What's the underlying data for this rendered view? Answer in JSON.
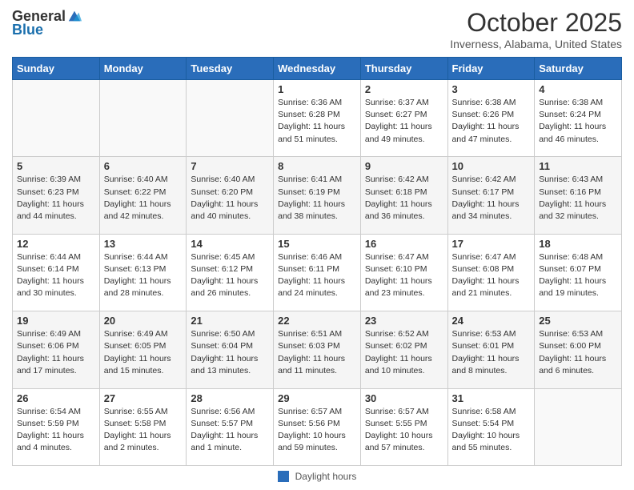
{
  "header": {
    "logo_general": "General",
    "logo_blue": "Blue",
    "title": "October 2025",
    "location": "Inverness, Alabama, United States"
  },
  "days_of_week": [
    "Sunday",
    "Monday",
    "Tuesday",
    "Wednesday",
    "Thursday",
    "Friday",
    "Saturday"
  ],
  "weeks": [
    [
      {
        "day": "",
        "info": ""
      },
      {
        "day": "",
        "info": ""
      },
      {
        "day": "",
        "info": ""
      },
      {
        "day": "1",
        "info": "Sunrise: 6:36 AM\nSunset: 6:28 PM\nDaylight: 11 hours\nand 51 minutes."
      },
      {
        "day": "2",
        "info": "Sunrise: 6:37 AM\nSunset: 6:27 PM\nDaylight: 11 hours\nand 49 minutes."
      },
      {
        "day": "3",
        "info": "Sunrise: 6:38 AM\nSunset: 6:26 PM\nDaylight: 11 hours\nand 47 minutes."
      },
      {
        "day": "4",
        "info": "Sunrise: 6:38 AM\nSunset: 6:24 PM\nDaylight: 11 hours\nand 46 minutes."
      }
    ],
    [
      {
        "day": "5",
        "info": "Sunrise: 6:39 AM\nSunset: 6:23 PM\nDaylight: 11 hours\nand 44 minutes."
      },
      {
        "day": "6",
        "info": "Sunrise: 6:40 AM\nSunset: 6:22 PM\nDaylight: 11 hours\nand 42 minutes."
      },
      {
        "day": "7",
        "info": "Sunrise: 6:40 AM\nSunset: 6:20 PM\nDaylight: 11 hours\nand 40 minutes."
      },
      {
        "day": "8",
        "info": "Sunrise: 6:41 AM\nSunset: 6:19 PM\nDaylight: 11 hours\nand 38 minutes."
      },
      {
        "day": "9",
        "info": "Sunrise: 6:42 AM\nSunset: 6:18 PM\nDaylight: 11 hours\nand 36 minutes."
      },
      {
        "day": "10",
        "info": "Sunrise: 6:42 AM\nSunset: 6:17 PM\nDaylight: 11 hours\nand 34 minutes."
      },
      {
        "day": "11",
        "info": "Sunrise: 6:43 AM\nSunset: 6:16 PM\nDaylight: 11 hours\nand 32 minutes."
      }
    ],
    [
      {
        "day": "12",
        "info": "Sunrise: 6:44 AM\nSunset: 6:14 PM\nDaylight: 11 hours\nand 30 minutes."
      },
      {
        "day": "13",
        "info": "Sunrise: 6:44 AM\nSunset: 6:13 PM\nDaylight: 11 hours\nand 28 minutes."
      },
      {
        "day": "14",
        "info": "Sunrise: 6:45 AM\nSunset: 6:12 PM\nDaylight: 11 hours\nand 26 minutes."
      },
      {
        "day": "15",
        "info": "Sunrise: 6:46 AM\nSunset: 6:11 PM\nDaylight: 11 hours\nand 24 minutes."
      },
      {
        "day": "16",
        "info": "Sunrise: 6:47 AM\nSunset: 6:10 PM\nDaylight: 11 hours\nand 23 minutes."
      },
      {
        "day": "17",
        "info": "Sunrise: 6:47 AM\nSunset: 6:08 PM\nDaylight: 11 hours\nand 21 minutes."
      },
      {
        "day": "18",
        "info": "Sunrise: 6:48 AM\nSunset: 6:07 PM\nDaylight: 11 hours\nand 19 minutes."
      }
    ],
    [
      {
        "day": "19",
        "info": "Sunrise: 6:49 AM\nSunset: 6:06 PM\nDaylight: 11 hours\nand 17 minutes."
      },
      {
        "day": "20",
        "info": "Sunrise: 6:49 AM\nSunset: 6:05 PM\nDaylight: 11 hours\nand 15 minutes."
      },
      {
        "day": "21",
        "info": "Sunrise: 6:50 AM\nSunset: 6:04 PM\nDaylight: 11 hours\nand 13 minutes."
      },
      {
        "day": "22",
        "info": "Sunrise: 6:51 AM\nSunset: 6:03 PM\nDaylight: 11 hours\nand 11 minutes."
      },
      {
        "day": "23",
        "info": "Sunrise: 6:52 AM\nSunset: 6:02 PM\nDaylight: 11 hours\nand 10 minutes."
      },
      {
        "day": "24",
        "info": "Sunrise: 6:53 AM\nSunset: 6:01 PM\nDaylight: 11 hours\nand 8 minutes."
      },
      {
        "day": "25",
        "info": "Sunrise: 6:53 AM\nSunset: 6:00 PM\nDaylight: 11 hours\nand 6 minutes."
      }
    ],
    [
      {
        "day": "26",
        "info": "Sunrise: 6:54 AM\nSunset: 5:59 PM\nDaylight: 11 hours\nand 4 minutes."
      },
      {
        "day": "27",
        "info": "Sunrise: 6:55 AM\nSunset: 5:58 PM\nDaylight: 11 hours\nand 2 minutes."
      },
      {
        "day": "28",
        "info": "Sunrise: 6:56 AM\nSunset: 5:57 PM\nDaylight: 11 hours\nand 1 minute."
      },
      {
        "day": "29",
        "info": "Sunrise: 6:57 AM\nSunset: 5:56 PM\nDaylight: 10 hours\nand 59 minutes."
      },
      {
        "day": "30",
        "info": "Sunrise: 6:57 AM\nSunset: 5:55 PM\nDaylight: 10 hours\nand 57 minutes."
      },
      {
        "day": "31",
        "info": "Sunrise: 6:58 AM\nSunset: 5:54 PM\nDaylight: 10 hours\nand 55 minutes."
      },
      {
        "day": "",
        "info": ""
      }
    ]
  ],
  "footer": {
    "legend_label": "Daylight hours"
  }
}
